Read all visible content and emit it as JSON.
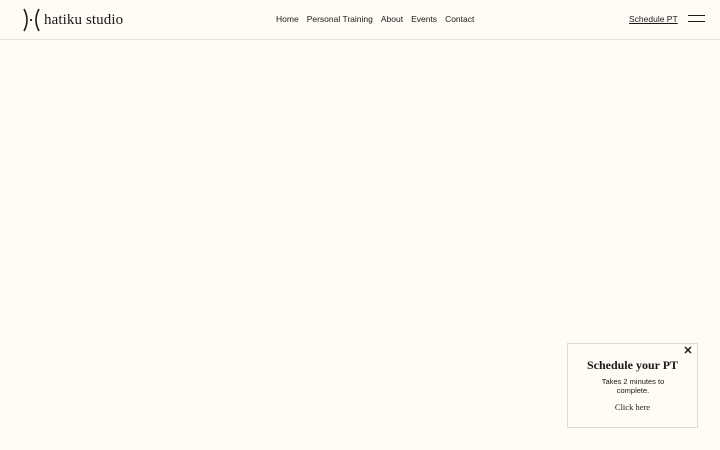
{
  "header": {
    "logo_text": "hatiku studio",
    "nav": [
      {
        "label": "Home"
      },
      {
        "label": "Personal Training"
      },
      {
        "label": "About"
      },
      {
        "label": "Events"
      },
      {
        "label": "Contact"
      }
    ],
    "cta_label": "Schedule PT",
    "menu_icon": "hamburger-menu-icon"
  },
  "popup": {
    "title": "Schedule your PT",
    "description": "Takes 2 minutes to complete.",
    "link_label": "Click here",
    "close_icon": "close-icon"
  },
  "colors": {
    "background": "#fefcf4",
    "text": "#1a1a1a",
    "border": "#dcdad2"
  }
}
